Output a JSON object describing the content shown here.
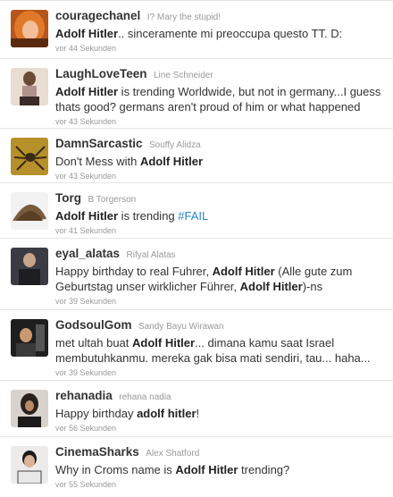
{
  "tweets": [
    {
      "username": "couragechanel",
      "fullname": "I? Mary the stupid!",
      "text": [
        {
          "t": "Adolf Hitler",
          "b": true
        },
        {
          "t": ".. sinceramente mi preoccupa questo TT. D:"
        }
      ],
      "time": "vor 44 Sekunden",
      "avatar_icon": "orange-hair-avatar-icon"
    },
    {
      "username": "LaughLoveTeen",
      "fullname": "Line Schneider",
      "text": [
        {
          "t": "Adolf Hitler",
          "b": true
        },
        {
          "t": " is trending Worldwide, but not in germany...I guess thats good? germans aren't proud of him or what happened"
        }
      ],
      "time": "vor 43 Sekunden",
      "avatar_icon": "person-avatar-icon"
    },
    {
      "username": "DamnSarcastic",
      "fullname": "Souffy Alidza",
      "text": [
        {
          "t": "Don't Mess with "
        },
        {
          "t": "Adolf Hitler",
          "b": true
        }
      ],
      "time": "vor 43 Sekunden",
      "avatar_icon": "spider-avatar-icon"
    },
    {
      "username": "Torg",
      "fullname": "B Torgerson",
      "text": [
        {
          "t": "Adolf Hitler",
          "b": true
        },
        {
          "t": " is trending "
        },
        {
          "t": "#FAIL",
          "link": true
        }
      ],
      "time": "vor 41 Sekunden",
      "avatar_icon": "dirt-pile-avatar-icon"
    },
    {
      "username": "eyal_alatas",
      "fullname": "Rifyal Alatas",
      "text": [
        {
          "t": "Happy birthday to real Fuhrer, "
        },
        {
          "t": "Adolf Hitler",
          "b": true
        },
        {
          "t": " (Alle gute zum Geburtstag unser wirklicher Führer, "
        },
        {
          "t": "Adolf Hitler",
          "b": true
        },
        {
          "t": ")-ns"
        }
      ],
      "time": "vor 39 Sekunden",
      "avatar_icon": "person-avatar-icon"
    },
    {
      "username": "GodsoulGom",
      "fullname": "Sandy Bayu Wirawan",
      "text": [
        {
          "t": "met ultah buat "
        },
        {
          "t": "Adolf Hitler",
          "b": true
        },
        {
          "t": "... dimana kamu saat Israel membutuhkanmu. mereka gak bisa mati sendiri, tau... haha..."
        }
      ],
      "time": "vor 39 Sekunden",
      "avatar_icon": "person-avatar-icon"
    },
    {
      "username": "rehanadia",
      "fullname": "rehana nadia",
      "text": [
        {
          "t": "Happy birthday "
        },
        {
          "t": "adolf hitler",
          "b": true
        },
        {
          "t": "!"
        }
      ],
      "time": "vor 56 Sekunden",
      "avatar_icon": "person-avatar-icon"
    },
    {
      "username": "CinemaSharks",
      "fullname": "Alex Shatford",
      "text": [
        {
          "t": "Why in Croms name is "
        },
        {
          "t": "Adolf Hitler",
          "b": true
        },
        {
          "t": " trending?"
        }
      ],
      "time": "vor 55 Sekunden",
      "avatar_icon": "person-avatar-icon"
    }
  ]
}
